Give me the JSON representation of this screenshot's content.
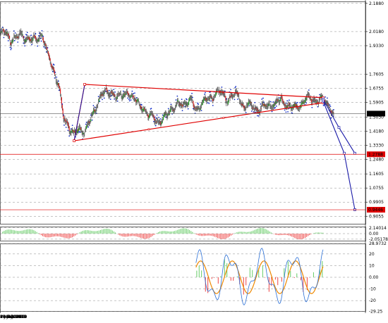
{
  "chart_data": [
    {
      "type": "line",
      "panel": "price",
      "ylim": [
        0.86,
        2.2
      ],
      "y_ticks": [
        "2.1880",
        "2.0180",
        "1.9330",
        "1.7605",
        "1.6755",
        "1.5905",
        "1.5030",
        "1.4180",
        "1.3330",
        "1.2480",
        "1.1605",
        "1.0755",
        "0.9905",
        "0.9055"
      ],
      "y_tick_values": [
        2.188,
        2.018,
        1.933,
        1.7605,
        1.6755,
        1.5905,
        1.503,
        1.418,
        1.333,
        1.248,
        1.1605,
        1.0755,
        0.9905,
        0.9055
      ],
      "x_tick_labels": [
        "Nov 2007",
        "6 Jul 2008",
        "15 Feb 2009",
        "27 Sep 2009",
        "9 May 2010",
        "19 Dec 2010",
        "31 Jul 2011",
        "11 Mar 2012",
        "21 Oct 2012"
      ],
      "price_labels": [
        {
          "text": "1.5238",
          "value": 1.5238,
          "color": "#000000"
        },
        {
          "text": "1.2788",
          "value": 1.2788,
          "color": "#e00000"
        },
        {
          "text": "0.9446",
          "value": 0.9446,
          "color": "#e00000"
        }
      ],
      "horizontal_lines": [
        {
          "value": 1.5238,
          "color": "#555555"
        },
        {
          "value": 1.2788,
          "color": "#e00000"
        },
        {
          "value": 0.9446,
          "color": "#e00000"
        }
      ],
      "triangle_vertices": [
        {
          "date": "Jan 2009",
          "price": 1.36
        },
        {
          "date": "Mar 2009",
          "price": 1.7
        },
        {
          "date": "Dec 2012",
          "price": 1.62
        },
        {
          "date": "Dec 2012",
          "price": 1.59
        }
      ],
      "triangle_apex_path": [
        {
          "date": "Jan 2009",
          "price": 1.36
        },
        {
          "date": "Dec 2012",
          "price": 1.595
        }
      ],
      "projection_paths": [
        [
          {
            "date": "Dec 2012",
            "price": 1.61
          },
          {
            "date": "Mar 2013",
            "price": 1.44
          },
          {
            "date": "Jun 2013",
            "price": 1.285
          }
        ],
        [
          {
            "date": "Dec 2012",
            "price": 1.6
          },
          {
            "date": "Apr 2013",
            "price": 1.285
          },
          {
            "date": "Jun 2013",
            "price": 0.945
          }
        ]
      ],
      "price_series": [
        [
          "Nov 2007",
          2.0
        ],
        [
          "Dec 2007",
          2.02
        ],
        [
          "Jan 2008",
          1.97
        ],
        [
          "Feb 2008",
          1.98
        ],
        [
          "Mar 2008",
          2.0
        ],
        [
          "Apr 2008",
          1.98
        ],
        [
          "May 2008",
          1.96
        ],
        [
          "Jun 2008",
          1.98
        ],
        [
          "Jul 2008",
          2.0
        ],
        [
          "Aug 2008",
          1.88
        ],
        [
          "Sep 2008",
          1.8
        ],
        [
          "Oct 2008",
          1.7
        ],
        [
          "Nov 2008",
          1.5
        ],
        [
          "Dec 2008",
          1.45
        ],
        [
          "Jan 2009",
          1.4
        ],
        [
          "Feb 2009",
          1.43
        ],
        [
          "Mar 2009",
          1.42
        ],
        [
          "Apr 2009",
          1.48
        ],
        [
          "May 2009",
          1.55
        ],
        [
          "Jun 2009",
          1.64
        ],
        [
          "Jul 2009",
          1.65
        ],
        [
          "Aug 2009",
          1.66
        ],
        [
          "Sep 2009",
          1.62
        ],
        [
          "Oct 2009",
          1.63
        ],
        [
          "Nov 2009",
          1.66
        ],
        [
          "Dec 2009",
          1.61
        ],
        [
          "Jan 2010",
          1.6
        ],
        [
          "Feb 2010",
          1.56
        ],
        [
          "Mar 2010",
          1.5
        ],
        [
          "Apr 2010",
          1.52
        ],
        [
          "May 2010",
          1.46
        ],
        [
          "Jun 2010",
          1.49
        ],
        [
          "Jul 2010",
          1.55
        ],
        [
          "Aug 2010",
          1.56
        ],
        [
          "Sep 2010",
          1.58
        ],
        [
          "Oct 2010",
          1.59
        ],
        [
          "Nov 2010",
          1.6
        ],
        [
          "Dec 2010",
          1.55
        ],
        [
          "Jan 2011",
          1.58
        ],
        [
          "Feb 2011",
          1.61
        ],
        [
          "Mar 2011",
          1.62
        ],
        [
          "Apr 2011",
          1.66
        ],
        [
          "May 2011",
          1.64
        ],
        [
          "Jun 2011",
          1.61
        ],
        [
          "Jul 2011",
          1.63
        ],
        [
          "Aug 2011",
          1.64
        ],
        [
          "Sep 2011",
          1.56
        ],
        [
          "Oct 2011",
          1.58
        ],
        [
          "Nov 2011",
          1.56
        ],
        [
          "Dec 2011",
          1.55
        ],
        [
          "Jan 2012",
          1.56
        ],
        [
          "Feb 2012",
          1.58
        ],
        [
          "Mar 2012",
          1.58
        ],
        [
          "Apr 2012",
          1.61
        ],
        [
          "May 2012",
          1.58
        ],
        [
          "Jun 2012",
          1.56
        ],
        [
          "Jul 2012",
          1.56
        ],
        [
          "Aug 2012",
          1.58
        ],
        [
          "Sep 2012",
          1.62
        ],
        [
          "Oct 2012",
          1.61
        ],
        [
          "Nov 2012",
          1.6
        ],
        [
          "Dec 2012",
          1.61
        ],
        [
          "Jan 2013",
          1.58
        ],
        [
          "Feb 2013",
          1.52
        ]
      ]
    },
    {
      "type": "bar",
      "panel": "histogram",
      "y_ticks": [
        "2.14014",
        "0.00",
        "-2.05178"
      ],
      "y_tick_values": [
        2.14014,
        0.0,
        -2.05178
      ],
      "colors": {
        "positive": "#66cc66",
        "negative": "#ee4444"
      }
    },
    {
      "type": "line",
      "panel": "oscillator",
      "ylim": [
        -28.97,
        28.97
      ],
      "y_ticks": [
        "28.9732",
        "20",
        "10",
        "0.00",
        "-10",
        "-20",
        "-29.25"
      ],
      "y_tick_values": [
        28.9732,
        20,
        10,
        0,
        -10,
        -20,
        -29.25
      ],
      "colors": {
        "fast": "#2a6fd6",
        "slow": "#ee8800"
      }
    }
  ]
}
